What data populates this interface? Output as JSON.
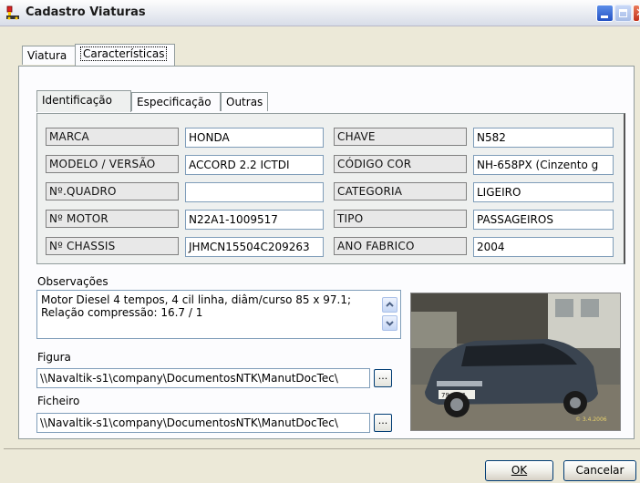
{
  "window": {
    "title": "Cadastro Viaturas"
  },
  "outer_tabs": [
    {
      "label": "Viatura",
      "active": false
    },
    {
      "label": "Características",
      "active": true
    }
  ],
  "inner_tabs": [
    {
      "label": "Identificação",
      "active": true
    },
    {
      "label": "Especificação",
      "active": false
    },
    {
      "label": "Outras",
      "active": false
    }
  ],
  "identificacao": {
    "left": [
      {
        "label": "MARCA",
        "value": "HONDA"
      },
      {
        "label": "MODELO / VERSÃO",
        "value": "ACCORD 2.2 ICTDI"
      },
      {
        "label": "Nº.QUADRO",
        "value": ""
      },
      {
        "label": "Nº MOTOR",
        "value": "N22A1-1009517"
      },
      {
        "label": "Nº CHASSIS",
        "value": "JHMCN15504C209263"
      }
    ],
    "right": [
      {
        "label": "CHAVE",
        "value": "N582"
      },
      {
        "label": "CÓDIGO COR",
        "value": "NH-658PX (Cinzento g"
      },
      {
        "label": "CATEGORIA",
        "value": "LIGEIRO"
      },
      {
        "label": "TIPO",
        "value": "PASSAGEIROS"
      },
      {
        "label": "ANO FABRICO",
        "value": "2004"
      }
    ]
  },
  "observacoes": {
    "label": "Observações",
    "line1": "Motor Diesel 4 tempos, 4 cil linha, diâm/curso 85 x 97.1;",
    "line2": "Relação compressão: 16.7 / 1"
  },
  "figura": {
    "label": "Figura",
    "path": "\\\\Navaltik-s1\\company\\DocumentosNTK\\ManutDocTec\\",
    "browse_label": "..."
  },
  "ficheiro": {
    "label": "Ficheiro",
    "path": "\\\\Navaltik-s1\\company\\DocumentosNTK\\ManutDocTec\\",
    "browse_label": "..."
  },
  "photo": {
    "plate": "79-16-1",
    "watermark": "© 3.4.2006"
  },
  "buttons": {
    "ok": "OK",
    "cancel": "Cancelar"
  },
  "colors": {
    "titlebar_close": "#c2321c",
    "titlebar_min": "#2452c4",
    "field_border": "#7f9db9"
  }
}
